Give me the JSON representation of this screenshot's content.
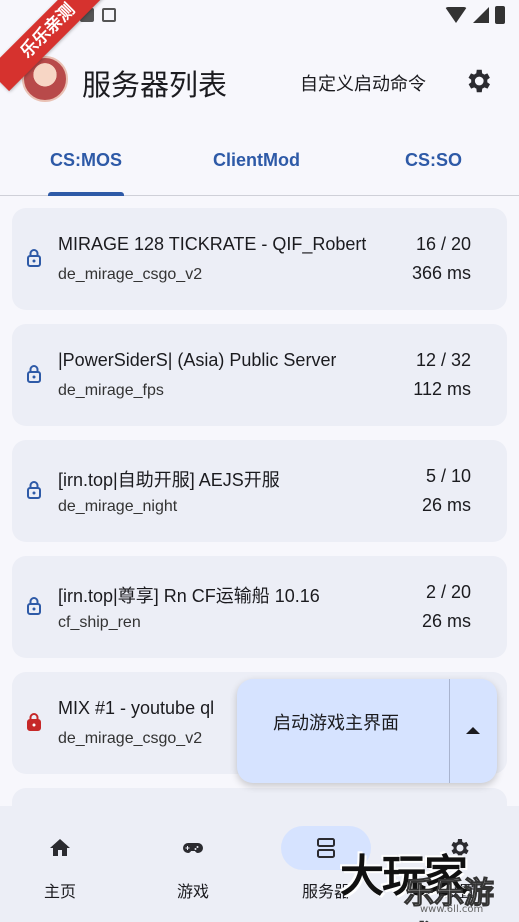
{
  "app": {
    "title": "服务器列表",
    "custom_command_label": "自定义启动命令"
  },
  "ribbon_text": "乐乐亲测",
  "tabs": [
    {
      "label": "CS:MOS",
      "active": true
    },
    {
      "label": "ClientMod",
      "active": false
    },
    {
      "label": "CS:SO",
      "active": false
    }
  ],
  "servers": [
    {
      "name": "MIRAGE 128 TICKRATE - QIF_Robert",
      "map": "de_mirage_csgo_v2",
      "players": "16 / 20",
      "ping": "366 ms",
      "lock_color": "#2e5aa7"
    },
    {
      "name": "|PowerSiderS| (Asia) Public Server",
      "map": "de_mirage_fps",
      "players": "12 / 32",
      "ping": "112 ms",
      "lock_color": "#2e5aa7"
    },
    {
      "name": "[irn.top|自助开服] AEJS开服",
      "map": "de_mirage_night",
      "players": "5 / 10",
      "ping": "26 ms",
      "lock_color": "#2e5aa7"
    },
    {
      "name": "[irn.top|尊享] Rn CF运输船 10.16",
      "map": "cf_ship_ren",
      "players": "2 / 20",
      "ping": "26 ms",
      "lock_color": "#2e5aa7"
    },
    {
      "name": "MIX #1 - youtube ql",
      "map": "de_mirage_csgo_v2",
      "players": "",
      "ping": "",
      "lock_color": "#c62828"
    }
  ],
  "fab": {
    "label": "启动游戏主界面"
  },
  "bottom_nav": [
    {
      "label": "主页",
      "icon": "home-icon",
      "active": false
    },
    {
      "label": "游戏",
      "icon": "gamepad-icon",
      "active": false
    },
    {
      "label": "服务器",
      "icon": "server-icon",
      "active": true
    },
    {
      "label": "设置",
      "icon": "gear-icon",
      "active": false
    }
  ],
  "watermark": {
    "main": "大玩家",
    "sub": "乐乐游戏",
    "url": "www.6ll.com"
  },
  "colors": {
    "accent": "#2e5aa7",
    "card_bg": "#eceef6",
    "fab_bg": "#d6e3ff",
    "ribbon": "#d6322e"
  }
}
